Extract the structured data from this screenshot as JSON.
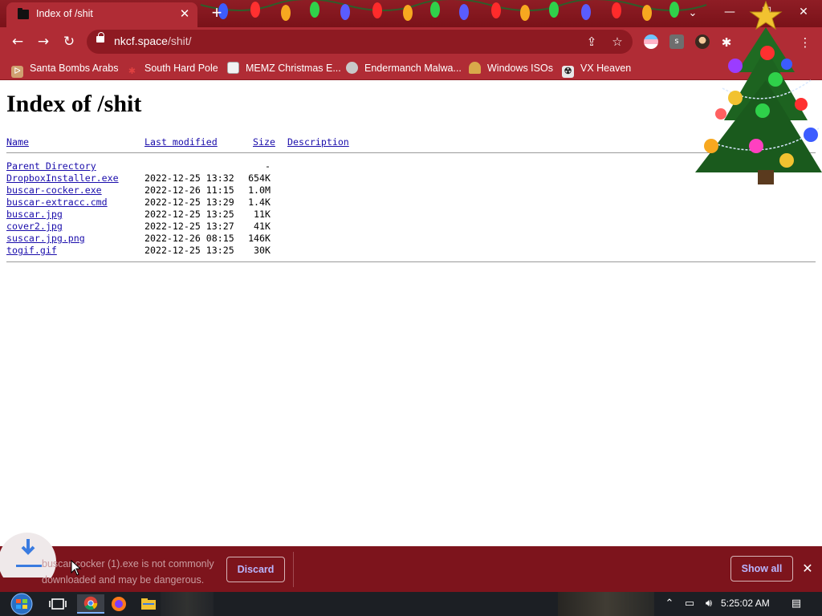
{
  "window": {
    "tab_title": "Index of /shit",
    "controls": {
      "minimize": "—",
      "maximize": "☐",
      "close": "✕"
    }
  },
  "toolbar": {
    "url_host": "nkcf.space",
    "url_path": "/shit/"
  },
  "bookmarks": [
    {
      "label": "Santa Bombs Arabs",
      "icon": "santa-icon",
      "color": "#d0a070"
    },
    {
      "label": "South Hard Pole",
      "icon": "snowflake-icon",
      "color": "#e04040"
    },
    {
      "label": "MEMZ Christmas E...",
      "icon": "image-icon",
      "color": "#f2f2f2"
    },
    {
      "label": "Endermanch Malwa...",
      "icon": "raccoon-icon",
      "color": "#c8c8c8"
    },
    {
      "label": "Windows ISOs",
      "icon": "elf-icon",
      "color": "#d9a94a"
    },
    {
      "label": "VX Heaven",
      "icon": "vx-icon",
      "color": "#e8e8e8"
    }
  ],
  "page": {
    "heading": "Index of /shit",
    "columns": {
      "name": "Name",
      "modified": "Last modified",
      "size": "Size",
      "description": "Description"
    },
    "parent": {
      "name": "Parent Directory",
      "size": "-"
    },
    "files": [
      {
        "name": "DropboxInstaller.exe",
        "modified": "2022-12-25 13:32",
        "size": "654K"
      },
      {
        "name": "buscar-cocker.exe",
        "modified": "2022-12-26 11:15",
        "size": "1.0M"
      },
      {
        "name": "buscar-extracc.cmd",
        "modified": "2022-12-25 13:29",
        "size": "1.4K"
      },
      {
        "name": "buscar.jpg",
        "modified": "2022-12-25 13:25",
        "size": "11K"
      },
      {
        "name": "cover2.jpg",
        "modified": "2022-12-25 13:27",
        "size": "41K"
      },
      {
        "name": "suscar.jpg.png",
        "modified": "2022-12-26 08:15",
        "size": "146K"
      },
      {
        "name": "togif.gif",
        "modified": "2022-12-25 13:25",
        "size": "30K"
      }
    ]
  },
  "download_shelf": {
    "message_line1": "buscar-cocker (1).exe is not commonly",
    "message_line2": "downloaded and may be dangerous.",
    "discard_label": "Discard",
    "show_all_label": "Show all"
  },
  "taskbar": {
    "clock": "5:25:02 AM"
  },
  "colors": {
    "theme_dark": "#7d141c",
    "theme_mid": "#b02c35",
    "link": "#1a0dab",
    "button_text": "#b9b6ff"
  }
}
